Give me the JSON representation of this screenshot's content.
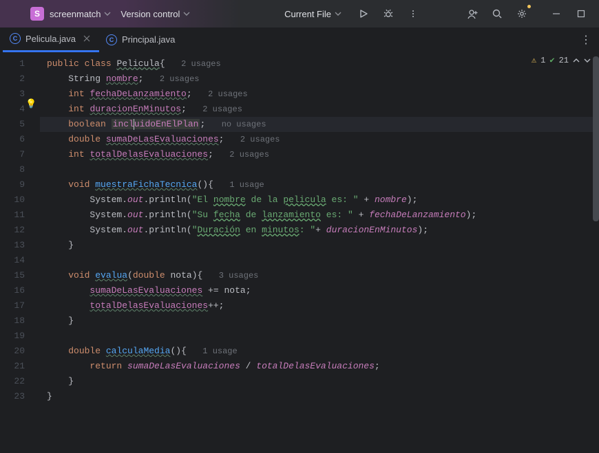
{
  "titlebar": {
    "project": "screenmatch",
    "vcs": "Version control",
    "runConfig": "Current File"
  },
  "tabs": {
    "t1": "Pelicula.java",
    "t2": "Principal.java"
  },
  "inspection": {
    "warnCount": "1",
    "okCount": "21"
  },
  "code": {
    "usages2": "2 usages",
    "usages1": "1 usage",
    "usages3": "3 usages",
    "noUsages": "no usages",
    "kw_public": "public",
    "kw_class": "class",
    "cls": "Pelicula",
    "lb": "{",
    "ty_String": "String",
    "fld_nombre": "nombre",
    "semi": ";",
    "ty_int": "int",
    "fld_fecha": "fechaDeLanzamiento",
    "fld_dur": "duracionEnMinutos",
    "ty_bool": "boolean",
    "fld_incA": "incl",
    "fld_incB": "uidoEnElPlan",
    "ty_double": "double",
    "fld_suma": "sumaDeLasEvaluaciones",
    "fld_total": "totalDelasEvaluaciones",
    "kw_void": "void",
    "m_ficha": "muestraFichaTecnica",
    "par": "()",
    "lb2": "{",
    "sys": "System",
    "dot": ".",
    "out": "out",
    "println": "println",
    "lp": "(",
    "s1a": "\"El ",
    "s1b": "nombre",
    "s1c": " de la ",
    "s1d": "pelicula",
    "s1e": " es: \"",
    "plus": " + ",
    "rp": ")",
    "semi2": ";",
    "s2a": "\"Su ",
    "s2b": "fecha",
    "s2c": " de ",
    "s2d": "lanzamiento",
    "s2e": " es: \"",
    "s3a": "\"",
    "s3b": "Duración",
    "s3c": " en ",
    "s3d": "minutos",
    "s3e": ": \"",
    "rb": "}",
    "m_eval": "evalua",
    "lp2": "(",
    "ty_d2": "double",
    "arg_nota": " nota",
    "rp2": ")",
    "lb3": "{",
    "pluseq": " += ",
    "nota": "nota",
    "semi3": ";",
    "inc": "++",
    "m_media": "calculaMedia",
    "kw_return": "return",
    "div": " / "
  }
}
